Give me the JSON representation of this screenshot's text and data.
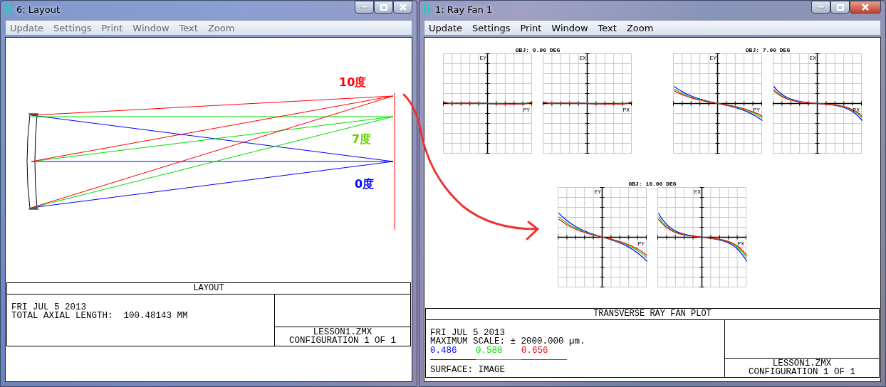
{
  "windows": [
    {
      "title": "6: Layout",
      "active": false,
      "menu": [
        "Update",
        "Settings",
        "Print",
        "Window",
        "Text",
        "Zoom"
      ],
      "annotations": [
        {
          "text": "10度",
          "color": "#ff0000"
        },
        {
          "text": "7度",
          "color": "#66cc00"
        },
        {
          "text": "0度",
          "color": "#0000ff"
        }
      ],
      "footer": {
        "title": "LAYOUT",
        "info": [
          "FRI JUL 5 2013",
          "TOTAL AXIAL LENGTH:  100.48143 MM"
        ],
        "file": "LESSON1.ZMX",
        "configuration": "CONFIGURATION 1 OF 1"
      }
    },
    {
      "title": "1: Ray Fan 1",
      "active": true,
      "menu": [
        "Update",
        "Settings",
        "Print",
        "Window",
        "Text",
        "Zoom"
      ],
      "plots": [
        {
          "title": "OBJ: 0.00 DEG",
          "fans": [
            {
              "kind": "tangential",
              "y_label": "EY",
              "x_label": "PY"
            },
            {
              "kind": "sagittal",
              "y_label": "EX",
              "x_label": "PX"
            }
          ]
        },
        {
          "title": "OBJ: 7.00 DEG",
          "fans": [
            {
              "kind": "tangential",
              "y_label": "EY",
              "x_label": "PY"
            },
            {
              "kind": "sagittal",
              "y_label": "EX",
              "x_label": "PX"
            }
          ]
        },
        {
          "title": "OBJ: 10.00 DEG",
          "fans": [
            {
              "kind": "tangential",
              "y_label": "EY",
              "x_label": "PY"
            },
            {
              "kind": "sagittal",
              "y_label": "EX",
              "x_label": "PX"
            }
          ]
        }
      ],
      "footer": {
        "title": "TRANSVERSE RAY FAN PLOT",
        "info": [
          "FRI JUL 5 2013",
          "MAXIMUM SCALE: ± 2000.000 µm."
        ],
        "wavelengths": [
          {
            "text": "0.486",
            "color": "#0000ff"
          },
          {
            "text": "0.588",
            "color": "#00dd00"
          },
          {
            "text": "0.656",
            "color": "#ff0000"
          }
        ],
        "surface": "SURFACE: IMAGE",
        "file": "LESSON1.ZMX",
        "configuration": "CONFIGURATION 1 OF 1"
      }
    }
  ]
}
